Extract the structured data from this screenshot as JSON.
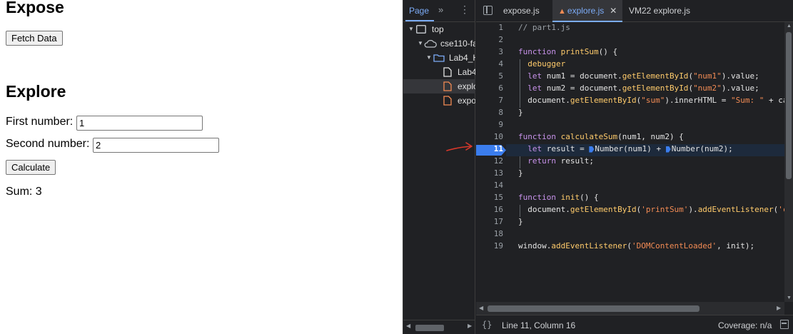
{
  "page": {
    "expose_heading": "Expose",
    "fetch_button": "Fetch Data",
    "explore_heading": "Explore",
    "first_label": "First number:",
    "first_value": "1",
    "second_label": "Second number:",
    "second_value": "2",
    "calculate_button": "Calculate",
    "sum_text": "Sum: 3"
  },
  "devtools": {
    "nav_tab": "Page",
    "tree": [
      {
        "label": "top"
      },
      {
        "label": "cse110-fa"
      },
      {
        "label": "Lab4_H"
      },
      {
        "label": "Lab4"
      },
      {
        "label": "explo"
      },
      {
        "label": "expo"
      }
    ],
    "file_tabs": [
      {
        "label": "expose.js"
      },
      {
        "label": "explore.js"
      },
      {
        "label": "VM22 explore.js"
      }
    ],
    "code_lines": [
      {
        "n": "1",
        "tokens": [
          [
            "cm",
            "// part1.js"
          ]
        ]
      },
      {
        "n": "2",
        "tokens": []
      },
      {
        "n": "3",
        "tokens": [
          [
            "kw",
            "function "
          ],
          [
            "fn",
            "printSum"
          ],
          [
            "pr",
            "() {"
          ]
        ]
      },
      {
        "n": "4",
        "tokens": [
          [
            "pr",
            "  "
          ],
          [
            "fn",
            "debugger"
          ]
        ]
      },
      {
        "n": "5",
        "tokens": [
          [
            "pr",
            "  "
          ],
          [
            "kw",
            "let "
          ],
          [
            "pr",
            "num1 = document."
          ],
          [
            "fn",
            "getElementById"
          ],
          [
            "pr",
            "("
          ],
          [
            "st",
            "\"num1\""
          ],
          [
            "pr",
            ").value;"
          ]
        ]
      },
      {
        "n": "6",
        "tokens": [
          [
            "pr",
            "  "
          ],
          [
            "kw",
            "let "
          ],
          [
            "pr",
            "num2 = document."
          ],
          [
            "fn",
            "getElementById"
          ],
          [
            "pr",
            "("
          ],
          [
            "st",
            "\"num2\""
          ],
          [
            "pr",
            ").value;"
          ]
        ]
      },
      {
        "n": "7",
        "tokens": [
          [
            "pr",
            "  document."
          ],
          [
            "fn",
            "getElementById"
          ],
          [
            "pr",
            "("
          ],
          [
            "st",
            "\"sum\""
          ],
          [
            "pr",
            ").innerHTML = "
          ],
          [
            "st",
            "\"Sum: \""
          ],
          [
            "pr",
            " + ca"
          ]
        ]
      },
      {
        "n": "8",
        "tokens": [
          [
            "pr",
            "}"
          ]
        ]
      },
      {
        "n": "9",
        "tokens": []
      },
      {
        "n": "10",
        "tokens": [
          [
            "kw",
            "function "
          ],
          [
            "fn",
            "calculateSum"
          ],
          [
            "pr",
            "(num1, num2) {"
          ]
        ]
      },
      {
        "n": "11",
        "tokens": [
          [
            "pr",
            "  "
          ],
          [
            "kw",
            "let "
          ],
          [
            "pr",
            "result = "
          ],
          [
            "inl",
            ""
          ],
          [
            "pr",
            "Number(num1) + "
          ],
          [
            "inl",
            ""
          ],
          [
            "pr",
            "Number(num2);"
          ]
        ]
      },
      {
        "n": "12",
        "tokens": [
          [
            "pr",
            "  "
          ],
          [
            "kw",
            "return "
          ],
          [
            "pr",
            "result;"
          ]
        ]
      },
      {
        "n": "13",
        "tokens": [
          [
            "pr",
            "}"
          ]
        ]
      },
      {
        "n": "14",
        "tokens": []
      },
      {
        "n": "15",
        "tokens": [
          [
            "kw",
            "function "
          ],
          [
            "fn",
            "init"
          ],
          [
            "pr",
            "() {"
          ]
        ]
      },
      {
        "n": "16",
        "tokens": [
          [
            "pr",
            "  document."
          ],
          [
            "fn",
            "getElementById"
          ],
          [
            "pr",
            "("
          ],
          [
            "st",
            "'printSum'"
          ],
          [
            "pr",
            ")."
          ],
          [
            "fn",
            "addEventListener"
          ],
          [
            "pr",
            "("
          ],
          [
            "st",
            "'c"
          ]
        ]
      },
      {
        "n": "17",
        "tokens": [
          [
            "pr",
            "}"
          ]
        ]
      },
      {
        "n": "18",
        "tokens": []
      },
      {
        "n": "19",
        "tokens": [
          [
            "pr",
            "window."
          ],
          [
            "fn",
            "addEventListener"
          ],
          [
            "pr",
            "("
          ],
          [
            "st",
            "'DOMContentLoaded'"
          ],
          [
            "pr",
            ", init);"
          ]
        ]
      }
    ],
    "breakpoint_line": 11,
    "status_position": "Line 11, Column 16",
    "coverage": "Coverage: n/a"
  }
}
